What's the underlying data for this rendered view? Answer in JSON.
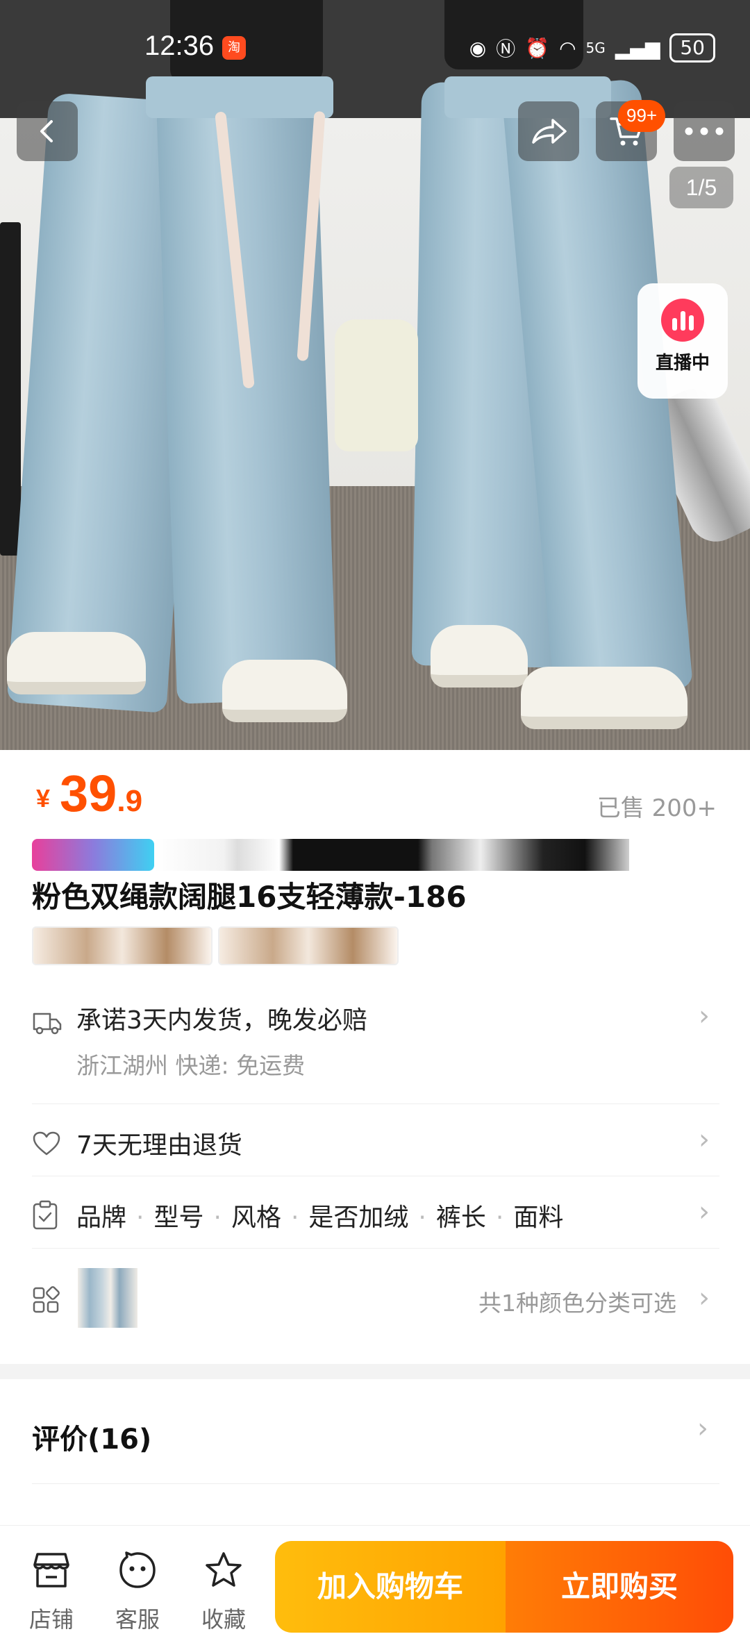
{
  "status_bar": {
    "time": "12:36",
    "app_badge": "淘",
    "network": "5G",
    "battery": "50"
  },
  "gallery": {
    "pager": "1/5",
    "cart_badge": "99+",
    "live_label": "直播中"
  },
  "product": {
    "price_symbol": "¥",
    "price_int": "39",
    "price_dec": ".9",
    "sold": "已售 200+",
    "title": "粉色双绳款阔腿16支轻薄款-186"
  },
  "rows": {
    "shipping_main": "承诺3天内发货，晚发必赔",
    "shipping_sub": "浙江湖州  快递: 免运费",
    "returns": "7天无理由退货",
    "params": [
      "品牌",
      "型号",
      "风格",
      "是否加绒",
      "裤长",
      "面料"
    ],
    "sku_text": "共1种颜色分类可选"
  },
  "reviews": {
    "title": "评价(16)"
  },
  "bottom_bar": {
    "shop": "店铺",
    "service": "客服",
    "favorite": "收藏",
    "add_to_cart": "加入购物车",
    "buy_now": "立即购买"
  },
  "colors": {
    "accent": "#ff5000",
    "cart_button": "#ffa200",
    "buy_button": "#ff4d06",
    "live_dot": "#ff3b5c"
  },
  "icons": [
    "back-icon",
    "share-icon",
    "cart-icon",
    "more-icon",
    "truck-icon",
    "heart-icon",
    "clipboard-icon",
    "grid-icon",
    "shop-icon",
    "service-icon",
    "star-icon"
  ]
}
